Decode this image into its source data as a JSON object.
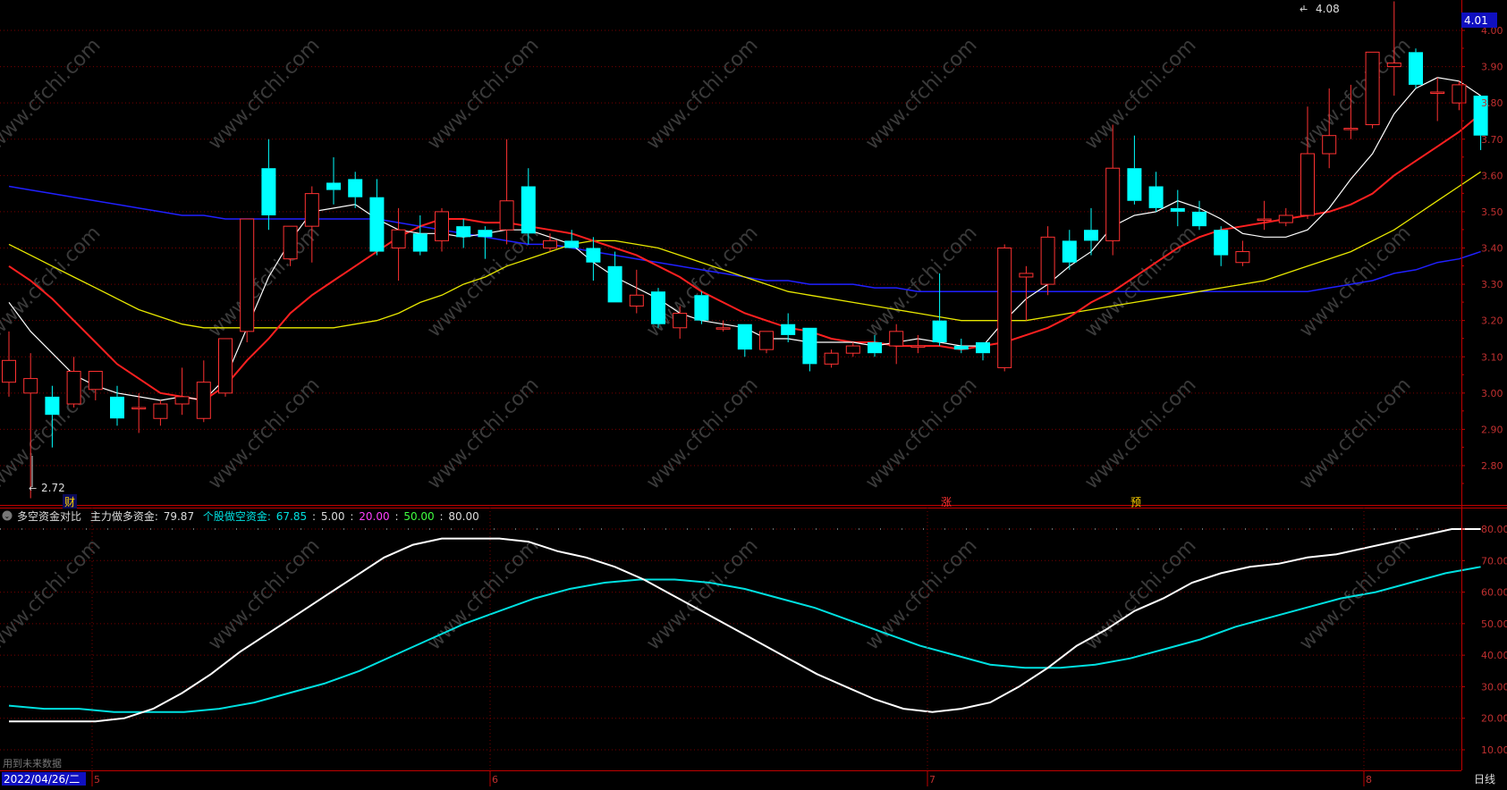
{
  "price_axis": {
    "ticks": [
      "4.00",
      "3.90",
      "3.80",
      "3.70",
      "3.60",
      "3.50",
      "3.40",
      "3.30",
      "3.20",
      "3.10",
      "3.00",
      "2.90",
      "2.80"
    ],
    "current_price": "4.01"
  },
  "annotations": {
    "high_label": "4.08",
    "low_label": "2.72",
    "event_cai": "财",
    "event_zhang": "涨",
    "event_yu": "预"
  },
  "indicator": {
    "name": "多空资金对比",
    "main_long_label": "主力做多资金:",
    "main_long_value": "79.87",
    "retail_short_label": "个股做空资金:",
    "retail_short_value": "67.85",
    "level_5": "5.00",
    "level_20": "20.00",
    "level_50": "50.00",
    "level_80": "80.00",
    "sep": ":",
    "ticks": [
      "80.00",
      "70.00",
      "60.00",
      "50.00",
      "40.00",
      "30.00",
      "20.00",
      "10.00"
    ],
    "note": "用到未来数据"
  },
  "time_axis": {
    "date": "2022/04/26/二",
    "months": [
      "5",
      "6",
      "7",
      "8"
    ],
    "period": "日线"
  },
  "watermark": "www.cfchi.com",
  "colors": {
    "up": "#ff3232",
    "down": "#00ffff",
    "ma5": "#ffffff",
    "ma10": "#ff2020",
    "ma20": "#e8e800",
    "ma60": "#2020ff",
    "grid": "#7a0000",
    "axis": "#c00000",
    "long_line": "#ffffff",
    "short_line": "#00e0e0"
  },
  "chart_data": {
    "type": "candlestick",
    "ylim": [
      2.72,
      4.08
    ],
    "candles": [
      {
        "o": 3.03,
        "h": 3.17,
        "l": 2.99,
        "c": 3.09
      },
      {
        "o": 3.0,
        "h": 3.11,
        "l": 2.71,
        "c": 3.04
      },
      {
        "o": 2.99,
        "h": 3.02,
        "l": 2.85,
        "c": 2.94
      },
      {
        "o": 2.97,
        "h": 3.1,
        "l": 2.96,
        "c": 3.06
      },
      {
        "o": 3.01,
        "h": 3.06,
        "l": 2.98,
        "c": 3.06
      },
      {
        "o": 2.99,
        "h": 3.02,
        "l": 2.91,
        "c": 2.93
      },
      {
        "o": 2.96,
        "h": 3.0,
        "l": 2.89,
        "c": 2.96
      },
      {
        "o": 2.93,
        "h": 2.98,
        "l": 2.91,
        "c": 2.97
      },
      {
        "o": 2.97,
        "h": 3.07,
        "l": 2.94,
        "c": 2.99
      },
      {
        "o": 2.93,
        "h": 3.09,
        "l": 2.92,
        "c": 3.03
      },
      {
        "o": 3.0,
        "h": 3.15,
        "l": 2.99,
        "c": 3.15
      },
      {
        "o": 3.17,
        "h": 3.48,
        "l": 3.14,
        "c": 3.48
      },
      {
        "o": 3.62,
        "h": 3.7,
        "l": 3.45,
        "c": 3.49
      },
      {
        "o": 3.37,
        "h": 3.46,
        "l": 3.35,
        "c": 3.46
      },
      {
        "o": 3.46,
        "h": 3.57,
        "l": 3.36,
        "c": 3.55
      },
      {
        "o": 3.58,
        "h": 3.65,
        "l": 3.52,
        "c": 3.56
      },
      {
        "o": 3.59,
        "h": 3.61,
        "l": 3.51,
        "c": 3.54
      },
      {
        "o": 3.54,
        "h": 3.59,
        "l": 3.38,
        "c": 3.39
      },
      {
        "o": 3.4,
        "h": 3.51,
        "l": 3.31,
        "c": 3.45
      },
      {
        "o": 3.44,
        "h": 3.49,
        "l": 3.38,
        "c": 3.39
      },
      {
        "o": 3.42,
        "h": 3.51,
        "l": 3.39,
        "c": 3.5
      },
      {
        "o": 3.46,
        "h": 3.48,
        "l": 3.4,
        "c": 3.43
      },
      {
        "o": 3.45,
        "h": 3.46,
        "l": 3.37,
        "c": 3.43
      },
      {
        "o": 3.45,
        "h": 3.7,
        "l": 3.41,
        "c": 3.53
      },
      {
        "o": 3.57,
        "h": 3.62,
        "l": 3.41,
        "c": 3.44
      },
      {
        "o": 3.4,
        "h": 3.44,
        "l": 3.39,
        "c": 3.42
      },
      {
        "o": 3.42,
        "h": 3.45,
        "l": 3.4,
        "c": 3.4
      },
      {
        "o": 3.4,
        "h": 3.43,
        "l": 3.31,
        "c": 3.36
      },
      {
        "o": 3.35,
        "h": 3.39,
        "l": 3.25,
        "c": 3.25
      },
      {
        "o": 3.24,
        "h": 3.34,
        "l": 3.22,
        "c": 3.27
      },
      {
        "o": 3.28,
        "h": 3.29,
        "l": 3.18,
        "c": 3.19
      },
      {
        "o": 3.18,
        "h": 3.24,
        "l": 3.15,
        "c": 3.22
      },
      {
        "o": 3.27,
        "h": 3.28,
        "l": 3.19,
        "c": 3.2
      },
      {
        "o": 3.18,
        "h": 3.2,
        "l": 3.17,
        "c": 3.18
      },
      {
        "o": 3.19,
        "h": 3.19,
        "l": 3.1,
        "c": 3.12
      },
      {
        "o": 3.12,
        "h": 3.17,
        "l": 3.11,
        "c": 3.17
      },
      {
        "o": 3.19,
        "h": 3.22,
        "l": 3.14,
        "c": 3.16
      },
      {
        "o": 3.18,
        "h": 3.18,
        "l": 3.06,
        "c": 3.08
      },
      {
        "o": 3.08,
        "h": 3.12,
        "l": 3.07,
        "c": 3.11
      },
      {
        "o": 3.11,
        "h": 3.14,
        "l": 3.1,
        "c": 3.13
      },
      {
        "o": 3.14,
        "h": 3.16,
        "l": 3.1,
        "c": 3.11
      },
      {
        "o": 3.13,
        "h": 3.19,
        "l": 3.08,
        "c": 3.17
      },
      {
        "o": 3.13,
        "h": 3.16,
        "l": 3.11,
        "c": 3.13
      },
      {
        "o": 3.2,
        "h": 3.33,
        "l": 3.13,
        "c": 3.14
      },
      {
        "o": 3.13,
        "h": 3.15,
        "l": 3.11,
        "c": 3.12
      },
      {
        "o": 3.14,
        "h": 3.14,
        "l": 3.09,
        "c": 3.11
      },
      {
        "o": 3.07,
        "h": 3.41,
        "l": 3.06,
        "c": 3.4
      },
      {
        "o": 3.32,
        "h": 3.35,
        "l": 3.2,
        "c": 3.33
      },
      {
        "o": 3.3,
        "h": 3.46,
        "l": 3.27,
        "c": 3.43
      },
      {
        "o": 3.42,
        "h": 3.45,
        "l": 3.34,
        "c": 3.36
      },
      {
        "o": 3.45,
        "h": 3.51,
        "l": 3.38,
        "c": 3.42
      },
      {
        "o": 3.42,
        "h": 3.74,
        "l": 3.38,
        "c": 3.62
      },
      {
        "o": 3.62,
        "h": 3.71,
        "l": 3.52,
        "c": 3.53
      },
      {
        "o": 3.57,
        "h": 3.61,
        "l": 3.5,
        "c": 3.51
      },
      {
        "o": 3.51,
        "h": 3.56,
        "l": 3.46,
        "c": 3.5
      },
      {
        "o": 3.5,
        "h": 3.53,
        "l": 3.45,
        "c": 3.46
      },
      {
        "o": 3.45,
        "h": 3.46,
        "l": 3.35,
        "c": 3.38
      },
      {
        "o": 3.36,
        "h": 3.42,
        "l": 3.35,
        "c": 3.39
      },
      {
        "o": 3.48,
        "h": 3.53,
        "l": 3.45,
        "c": 3.48
      },
      {
        "o": 3.47,
        "h": 3.51,
        "l": 3.46,
        "c": 3.49
      },
      {
        "o": 3.49,
        "h": 3.79,
        "l": 3.48,
        "c": 3.66
      },
      {
        "o": 3.66,
        "h": 3.84,
        "l": 3.62,
        "c": 3.71
      },
      {
        "o": 3.73,
        "h": 3.85,
        "l": 3.7,
        "c": 3.73
      },
      {
        "o": 3.74,
        "h": 3.94,
        "l": 3.73,
        "c": 3.94
      },
      {
        "o": 3.9,
        "h": 4.08,
        "l": 3.82,
        "c": 3.91
      },
      {
        "o": 3.94,
        "h": 3.95,
        "l": 3.84,
        "c": 3.85
      },
      {
        "o": 3.83,
        "h": 3.87,
        "l": 3.75,
        "c": 3.83
      },
      {
        "o": 3.8,
        "h": 3.86,
        "l": 3.78,
        "c": 3.85
      },
      {
        "o": 3.82,
        "h": 3.82,
        "l": 3.67,
        "c": 3.71
      }
    ],
    "ma5": [
      3.25,
      3.17,
      3.11,
      3.05,
      3.02,
      3.0,
      2.99,
      2.98,
      2.99,
      2.98,
      3.04,
      3.18,
      3.32,
      3.42,
      3.5,
      3.51,
      3.52,
      3.48,
      3.45,
      3.44,
      3.44,
      3.43,
      3.44,
      3.45,
      3.45,
      3.43,
      3.41,
      3.36,
      3.32,
      3.29,
      3.26,
      3.22,
      3.2,
      3.19,
      3.18,
      3.15,
      3.15,
      3.14,
      3.14,
      3.14,
      3.13,
      3.14,
      3.15,
      3.14,
      3.13,
      3.13,
      3.2,
      3.26,
      3.3,
      3.35,
      3.39,
      3.46,
      3.49,
      3.5,
      3.53,
      3.51,
      3.48,
      3.44,
      3.43,
      3.43,
      3.45,
      3.51,
      3.59,
      3.66,
      3.77,
      3.84,
      3.87,
      3.86,
      3.82
    ],
    "ma10": [
      3.35,
      3.31,
      3.26,
      3.2,
      3.14,
      3.08,
      3.04,
      3.0,
      2.99,
      2.98,
      3.02,
      3.09,
      3.15,
      3.22,
      3.27,
      3.31,
      3.35,
      3.39,
      3.43,
      3.46,
      3.48,
      3.48,
      3.47,
      3.47,
      3.46,
      3.45,
      3.44,
      3.42,
      3.4,
      3.38,
      3.35,
      3.32,
      3.28,
      3.25,
      3.22,
      3.2,
      3.18,
      3.17,
      3.15,
      3.14,
      3.14,
      3.13,
      3.13,
      3.13,
      3.12,
      3.13,
      3.14,
      3.16,
      3.18,
      3.21,
      3.25,
      3.28,
      3.32,
      3.36,
      3.4,
      3.43,
      3.45,
      3.46,
      3.47,
      3.48,
      3.49,
      3.5,
      3.52,
      3.55,
      3.6,
      3.64,
      3.68,
      3.72,
      3.77
    ],
    "ma20": [
      3.41,
      3.38,
      3.35,
      3.32,
      3.29,
      3.26,
      3.23,
      3.21,
      3.19,
      3.18,
      3.18,
      3.18,
      3.18,
      3.18,
      3.18,
      3.18,
      3.19,
      3.2,
      3.22,
      3.25,
      3.27,
      3.3,
      3.32,
      3.35,
      3.37,
      3.39,
      3.41,
      3.42,
      3.42,
      3.41,
      3.4,
      3.38,
      3.36,
      3.34,
      3.32,
      3.3,
      3.28,
      3.27,
      3.26,
      3.25,
      3.24,
      3.23,
      3.22,
      3.21,
      3.2,
      3.2,
      3.2,
      3.2,
      3.21,
      3.22,
      3.23,
      3.24,
      3.25,
      3.26,
      3.27,
      3.28,
      3.29,
      3.3,
      3.31,
      3.33,
      3.35,
      3.37,
      3.39,
      3.42,
      3.45,
      3.49,
      3.53,
      3.57,
      3.61
    ],
    "ma60": [
      3.57,
      3.56,
      3.55,
      3.54,
      3.53,
      3.52,
      3.51,
      3.5,
      3.49,
      3.49,
      3.48,
      3.48,
      3.48,
      3.48,
      3.48,
      3.48,
      3.48,
      3.48,
      3.47,
      3.46,
      3.45,
      3.44,
      3.43,
      3.42,
      3.41,
      3.41,
      3.4,
      3.39,
      3.38,
      3.37,
      3.36,
      3.35,
      3.34,
      3.33,
      3.32,
      3.31,
      3.31,
      3.3,
      3.3,
      3.3,
      3.29,
      3.29,
      3.28,
      3.28,
      3.28,
      3.28,
      3.28,
      3.28,
      3.28,
      3.28,
      3.28,
      3.28,
      3.28,
      3.28,
      3.28,
      3.28,
      3.28,
      3.28,
      3.28,
      3.28,
      3.28,
      3.29,
      3.3,
      3.31,
      3.33,
      3.34,
      3.36,
      3.37,
      3.39
    ],
    "indicator_ylim": [
      10,
      80
    ],
    "main_long": [
      19,
      19,
      19,
      19,
      20,
      23,
      28,
      34,
      41,
      47,
      53,
      59,
      65,
      71,
      75,
      77,
      77,
      77,
      76,
      73,
      71,
      68,
      64,
      59,
      54,
      49,
      44,
      39,
      34,
      30,
      26,
      23,
      22,
      23,
      25,
      30,
      36,
      43,
      48,
      54,
      58,
      63,
      66,
      68,
      69,
      71,
      72,
      74,
      76,
      78,
      80,
      80
    ],
    "retail_short": [
      24,
      23,
      23,
      22,
      22,
      22,
      23,
      25,
      28,
      31,
      35,
      40,
      45,
      50,
      54,
      58,
      61,
      63,
      64,
      64,
      63,
      61,
      58,
      55,
      51,
      47,
      43,
      40,
      37,
      36,
      36,
      37,
      39,
      42,
      45,
      49,
      52,
      55,
      58,
      60,
      63,
      66,
      68
    ],
    "series": [
      {
        "name": "主力做多资金"
      },
      {
        "name": "个股做空资金"
      }
    ]
  }
}
